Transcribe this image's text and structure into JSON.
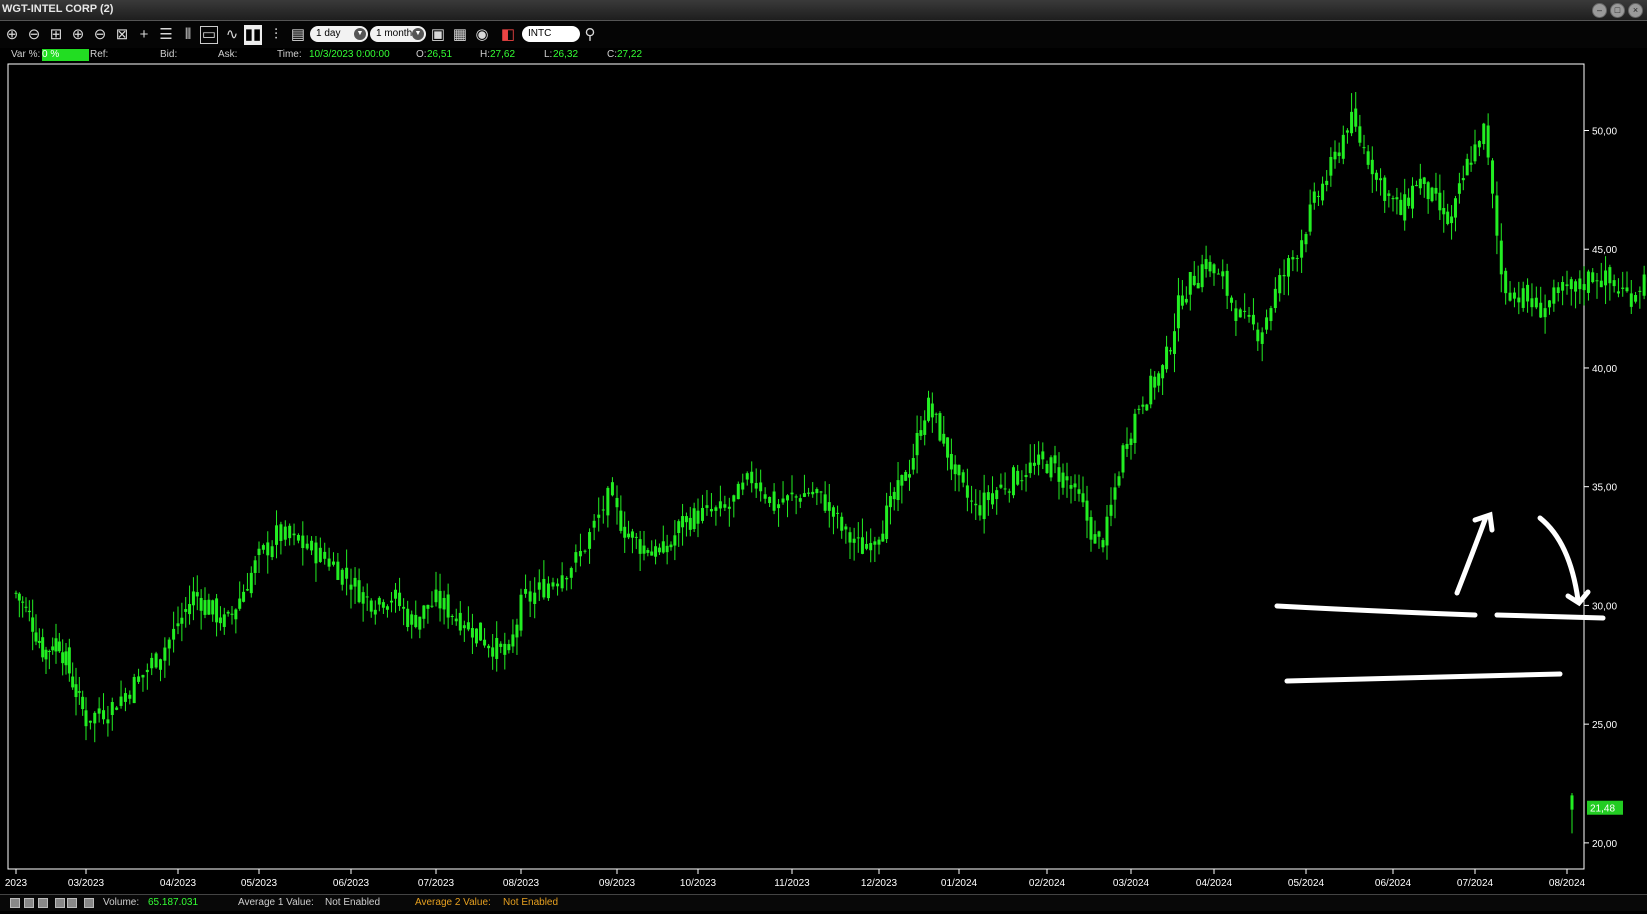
{
  "window": {
    "title": "WGT-INTEL CORP (2)"
  },
  "toolbar": {
    "period": "1 day",
    "range": "1 month",
    "symbol": "INTC",
    "icons": [
      "zoom-in-icon",
      "zoom-out-icon",
      "zoom-fit-icon",
      "zoom-y-in-icon",
      "zoom-y-out-icon",
      "zoom-all-icon",
      "crosshair-icon",
      "list-icon",
      "bars-icon",
      "window-icon",
      "line-chart-icon",
      "candle-icon",
      "ohlc-icon"
    ]
  },
  "info": {
    "var_label": "Var %:",
    "var_value": "0 %",
    "ref_label": "Ref:",
    "bid_label": "Bid:",
    "ask_label": "Ask:",
    "time_label": "Time:",
    "time_value": "10/3/2023 0:00:00",
    "o_label": "O:",
    "o_value": "26,51",
    "h_label": "H:",
    "h_value": "27,62",
    "l_label": "L:",
    "l_value": "26,32",
    "c_label": "C:",
    "c_value": "27,22"
  },
  "chart_data": {
    "type": "candlestick",
    "x_tick_labels": [
      "2023",
      "03/2023",
      "04/2023",
      "05/2023",
      "06/2023",
      "07/2023",
      "08/2023",
      "09/2023",
      "10/2023",
      "11/2023",
      "12/2023",
      "01/2024",
      "02/2024",
      "03/2024",
      "04/2024",
      "05/2024",
      "06/2024",
      "07/2024",
      "08/2024"
    ],
    "y_ticks": [
      "50,00",
      "45,00",
      "40,00",
      "35,00",
      "30,00",
      "25,00",
      "20,00"
    ],
    "ylim": [
      18.9,
      52.8
    ],
    "last_price": "21,48",
    "close_anchors": [
      [
        0,
        30.5
      ],
      [
        0.2,
        29.5
      ],
      [
        0.4,
        28.0
      ],
      [
        0.6,
        28.6
      ],
      [
        0.9,
        26.0
      ],
      [
        1.0,
        25.2
      ],
      [
        1.3,
        25.8
      ],
      [
        1.6,
        27.0
      ],
      [
        1.9,
        28.5
      ],
      [
        2.2,
        30.5
      ],
      [
        2.6,
        29.2
      ],
      [
        3.0,
        32.0
      ],
      [
        3.2,
        33.0
      ],
      [
        3.5,
        32.5
      ],
      [
        3.8,
        31.8
      ],
      [
        4.0,
        31.0
      ],
      [
        4.2,
        30.2
      ],
      [
        4.5,
        30.4
      ],
      [
        4.7,
        29.3
      ],
      [
        5.0,
        30.2
      ],
      [
        5.3,
        29.4
      ],
      [
        5.6,
        28.5
      ],
      [
        5.85,
        27.8
      ],
      [
        6.0,
        30.0
      ],
      [
        6.3,
        31.0
      ],
      [
        6.6,
        32.0
      ],
      [
        6.9,
        34.5
      ],
      [
        7.1,
        33.2
      ],
      [
        7.3,
        32.5
      ],
      [
        7.6,
        32.2
      ],
      [
        7.8,
        33.5
      ],
      [
        8.0,
        33.8
      ],
      [
        8.3,
        34.0
      ],
      [
        8.6,
        35.5
      ],
      [
        8.8,
        34.2
      ],
      [
        9.0,
        34.5
      ],
      [
        9.2,
        34.8
      ],
      [
        9.4,
        34.3
      ],
      [
        9.6,
        33.0
      ],
      [
        9.8,
        32.4
      ],
      [
        10.0,
        33.2
      ],
      [
        10.2,
        34.5
      ],
      [
        10.4,
        36.0
      ],
      [
        10.6,
        38.5
      ],
      [
        10.8,
        37.0
      ],
      [
        11.0,
        35.0
      ],
      [
        11.2,
        34.0
      ],
      [
        11.4,
        34.8
      ],
      [
        11.6,
        35.3
      ],
      [
        11.8,
        35.8
      ],
      [
        12.0,
        36.0
      ],
      [
        12.2,
        35.4
      ],
      [
        12.4,
        34.3
      ],
      [
        12.6,
        32.5
      ],
      [
        12.7,
        33.0
      ],
      [
        12.9,
        36.5
      ],
      [
        13.1,
        38.5
      ],
      [
        13.4,
        40.0
      ],
      [
        13.6,
        43.0
      ],
      [
        13.9,
        44.5
      ],
      [
        14.1,
        43.5
      ],
      [
        14.3,
        42.0
      ],
      [
        14.5,
        41.5
      ],
      [
        14.7,
        43.5
      ],
      [
        14.9,
        45.0
      ],
      [
        15.1,
        47.0
      ],
      [
        15.3,
        48.5
      ],
      [
        15.5,
        50.5
      ],
      [
        15.7,
        49.0
      ],
      [
        15.9,
        47.5
      ],
      [
        16.1,
        46.5
      ],
      [
        16.3,
        48.0
      ],
      [
        16.5,
        47.0
      ],
      [
        16.7,
        46.0
      ],
      [
        16.9,
        48.5
      ],
      [
        17.1,
        50.0
      ],
      [
        17.3,
        43.5
      ],
      [
        17.5,
        43.0
      ],
      [
        17.7,
        42.5
      ],
      [
        17.9,
        43.0
      ],
      [
        18.1,
        43.3
      ],
      [
        18.3,
        44.0
      ],
      [
        18.5,
        43.5
      ],
      [
        18.7,
        43.0
      ],
      [
        18.9,
        44.0
      ],
      [
        19.1,
        44.5
      ],
      [
        19.3,
        43.5
      ],
      [
        19.5,
        43.0
      ],
      [
        19.7,
        42.5
      ],
      [
        19.9,
        42.0
      ],
      [
        20.1,
        41.0
      ],
      [
        20.3,
        39.0
      ],
      [
        20.5,
        37.0
      ],
      [
        20.7,
        35.5
      ],
      [
        20.9,
        34.0
      ],
      [
        21.1,
        34.5
      ],
      [
        21.2,
        32.0
      ],
      [
        21.4,
        30.5
      ],
      [
        21.6,
        30.2
      ],
      [
        21.8,
        30.0
      ],
      [
        22.0,
        30.5
      ],
      [
        22.2,
        31.5
      ],
      [
        22.4,
        31.0
      ],
      [
        22.6,
        30.4
      ],
      [
        22.8,
        30.3
      ],
      [
        23.0,
        30.4
      ],
      [
        23.2,
        30.5
      ],
      [
        23.4,
        30.6
      ],
      [
        23.6,
        30.8
      ],
      [
        23.8,
        30.8
      ],
      [
        24.0,
        31.0
      ],
      [
        24.2,
        31.5
      ],
      [
        24.4,
        33.0
      ],
      [
        24.6,
        34.5
      ],
      [
        24.8,
        35.0
      ],
      [
        25.0,
        33.5
      ],
      [
        25.2,
        32.0
      ],
      [
        25.4,
        31.2
      ],
      [
        25.6,
        30.5
      ],
      [
        25.8,
        30.0
      ],
      [
        26.0,
        29.5
      ]
    ]
  },
  "drawings": {
    "color": "#ffffff"
  },
  "status": {
    "volume_label": "Volume:",
    "volume_value": "65.187.031",
    "avg1_label": "Average 1 Value:",
    "avg1_value": "Not Enabled",
    "avg2_label": "Average 2 Value:",
    "avg2_value": "Not Enabled"
  },
  "colors": {
    "candle": "#22ee22",
    "axis": "#ffffff",
    "background": "#000000",
    "accent": "#34ff34",
    "avg2": "#e6a020"
  }
}
